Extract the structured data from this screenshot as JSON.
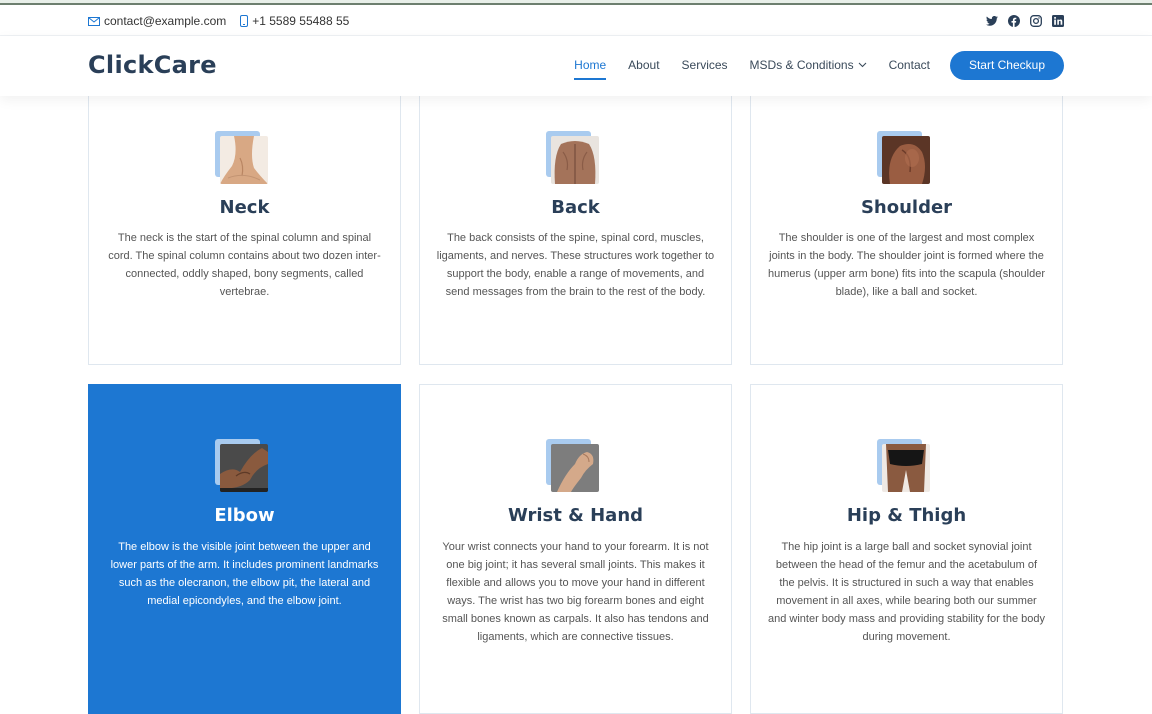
{
  "topbar": {
    "email": "contact@example.com",
    "phone": "+1 5589 55488 55",
    "social_icons": [
      "twitter-icon",
      "facebook-icon",
      "instagram-icon",
      "linkedin-icon"
    ]
  },
  "header": {
    "logo": "ClickCare",
    "nav": [
      {
        "label": "Home",
        "active": true
      },
      {
        "label": "About"
      },
      {
        "label": "Services"
      },
      {
        "label": "MSDs & Conditions",
        "dropdown": true
      },
      {
        "label": "Contact"
      }
    ],
    "cta": "Start Checkup"
  },
  "colors": {
    "brand_blue": "#1d77d2",
    "heading": "#2a3f58",
    "icon_back": "#a9cbef"
  },
  "cards": [
    {
      "title": "Neck",
      "text": "The neck is the start of the spinal column and spinal cord. The spinal column contains about two dozen inter-connected, oddly shaped, bony segments, called vertebrae."
    },
    {
      "title": "Back",
      "text": "The back consists of the spine, spinal cord, muscles, ligaments, and nerves. These structures work together to support the body, enable a range of movements, and send messages from the brain to the rest of the body."
    },
    {
      "title": "Shoulder",
      "text": "The shoulder is one of the largest and most complex joints in the body. The shoulder joint is formed where the humerus (upper arm bone) fits into the scapula (shoulder blade), like a ball and socket."
    },
    {
      "title": "Elbow",
      "text": "The elbow is the visible joint between the upper and lower parts of the arm. It includes prominent landmarks such as the olecranon, the elbow pit, the lateral and medial epicondyles, and the elbow joint.",
      "active": true
    },
    {
      "title": "Wrist & Hand",
      "text": "Your wrist connects your hand to your forearm. It is not one big joint; it has several small joints. This makes it flexible and allows you to move your hand in different ways. The wrist has two big forearm bones and eight small bones known as carpals. It also has tendons and ligaments, which are connective tissues."
    },
    {
      "title": "Hip & Thigh",
      "text": "The hip joint is a large ball and socket synovial joint between the head of the femur and the acetabulum of the pelvis. It is structured in such a way that enables movement in all axes, while bearing both our summer and winter body mass and providing stability for the body during movement."
    }
  ]
}
